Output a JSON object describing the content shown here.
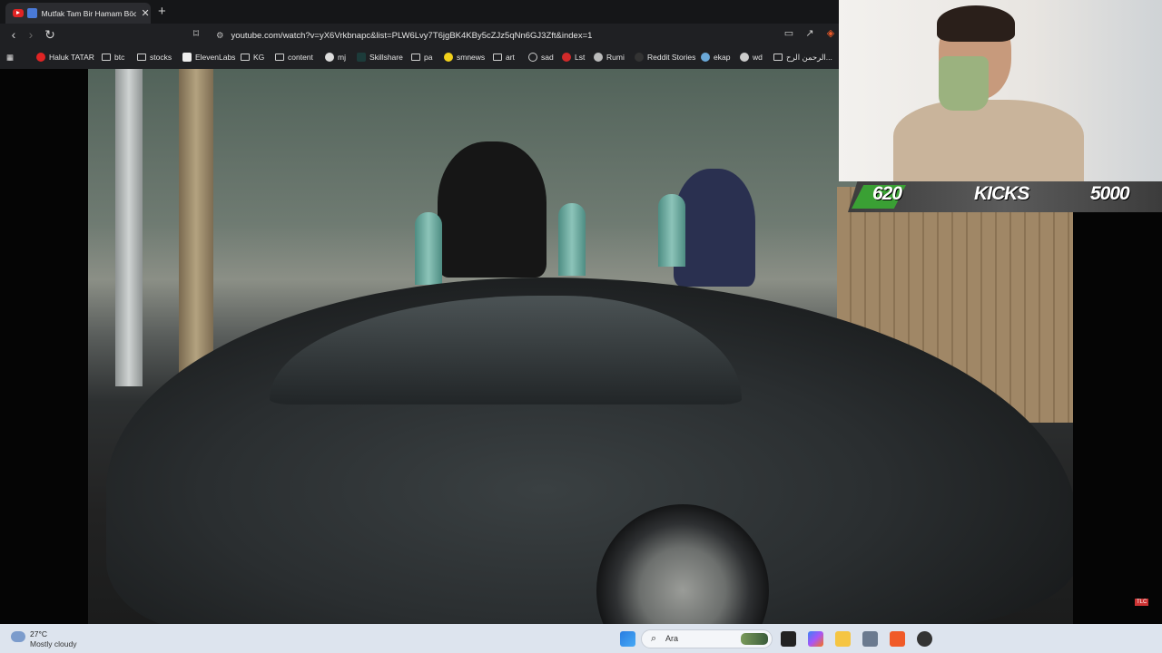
{
  "browser": {
    "tab_title": "Mutfak Tam Bir Hamam Böceği",
    "tab_close": "✕",
    "new_tab": "+",
    "url": "youtube.com/watch?v=yX6Vrkbnapc&list=PLW6Lvy7T6jgBK4KBy5cZJz5qNn6GJ3Zft&index=1"
  },
  "bookmarks": [
    {
      "label": "Haluk TATAR"
    },
    {
      "label": "btc"
    },
    {
      "label": "stocks"
    },
    {
      "label": "ElevenLabs"
    },
    {
      "label": "KG"
    },
    {
      "label": "content"
    },
    {
      "label": "mj"
    },
    {
      "label": "Skillshare"
    },
    {
      "label": "pa"
    },
    {
      "label": "smnews"
    },
    {
      "label": "art"
    },
    {
      "label": "sad"
    },
    {
      "label": "Lst"
    },
    {
      "label": "Rumi"
    },
    {
      "label": "Reddit Stories"
    },
    {
      "label": "ekap"
    },
    {
      "label": "wd"
    },
    {
      "label": "الرحمن الرح..."
    }
  ],
  "overlay": {
    "left_score": "620",
    "center_label": "KICKS",
    "right_score": "5000",
    "channel_logo": "TLC"
  },
  "taskbar": {
    "temperature": "27°C",
    "weather": "Mostly cloudy",
    "search_placeholder": "Ara"
  }
}
